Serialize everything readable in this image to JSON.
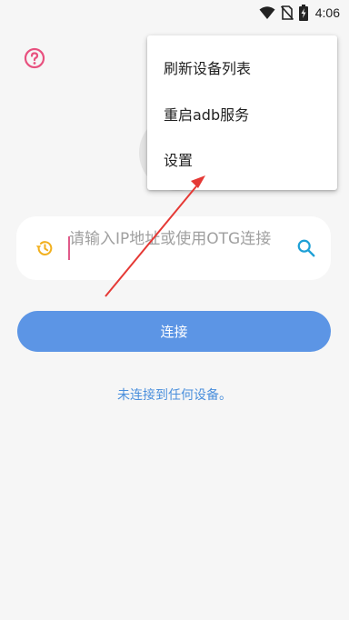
{
  "status_bar": {
    "time": "4:06",
    "icons": [
      "wifi-icon",
      "no-sim-icon",
      "battery-charging-icon"
    ]
  },
  "header": {
    "help_icon": "help-circle-icon",
    "help_icon_color": "#e8517f"
  },
  "menu": {
    "items": [
      {
        "label": "刷新设备列表"
      },
      {
        "label": "重启adb服务"
      },
      {
        "label": "设置"
      }
    ]
  },
  "connect_form": {
    "history_icon": "history-icon",
    "history_icon_color": "#f2b01e",
    "input_placeholder": "请输入IP地址或使用OTG连接",
    "search_icon": "search-icon",
    "search_icon_color": "#1ea0d6",
    "connect_label": "连接",
    "button_color": "#5c95e5"
  },
  "connection_status": "未连接到任何设备。",
  "annotation": {
    "arrow_color": "#e53935"
  }
}
